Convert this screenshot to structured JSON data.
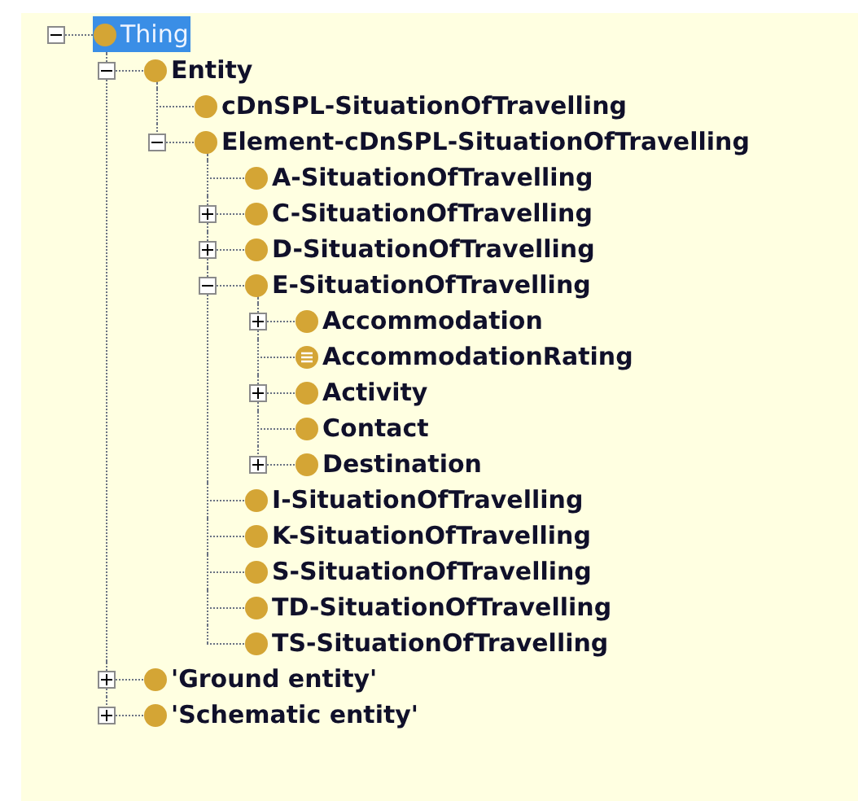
{
  "tree": {
    "items": [
      {
        "label": "Thing",
        "kind": "class",
        "selected": true,
        "expanded": true,
        "children": [
          {
            "label": "Entity",
            "kind": "class",
            "selected": false,
            "expanded": true,
            "children": [
              {
                "label": "cDnSPL-SituationOfTravelling",
                "kind": "class",
                "selected": false
              },
              {
                "label": "Element-cDnSPL-SituationOfTravelling",
                "kind": "class",
                "selected": false,
                "expanded": true,
                "children": [
                  {
                    "label": "A-SituationOfTravelling",
                    "kind": "class",
                    "selected": false
                  },
                  {
                    "label": "C-SituationOfTravelling",
                    "kind": "class",
                    "selected": false,
                    "expanded": false
                  },
                  {
                    "label": "D-SituationOfTravelling",
                    "kind": "class",
                    "selected": false,
                    "expanded": false
                  },
                  {
                    "label": "E-SituationOfTravelling",
                    "kind": "class",
                    "selected": false,
                    "expanded": true,
                    "children": [
                      {
                        "label": "Accommodation",
                        "kind": "class",
                        "selected": false,
                        "expanded": false
                      },
                      {
                        "label": "AccommodationRating",
                        "kind": "enumerated",
                        "selected": false
                      },
                      {
                        "label": "Activity",
                        "kind": "class",
                        "selected": false,
                        "expanded": false
                      },
                      {
                        "label": "Contact",
                        "kind": "class",
                        "selected": false
                      },
                      {
                        "label": "Destination",
                        "kind": "class",
                        "selected": false,
                        "expanded": false
                      }
                    ]
                  },
                  {
                    "label": "I-SituationOfTravelling",
                    "kind": "class",
                    "selected": false
                  },
                  {
                    "label": "K-SituationOfTravelling",
                    "kind": "class",
                    "selected": false
                  },
                  {
                    "label": "S-SituationOfTravelling",
                    "kind": "class",
                    "selected": false
                  },
                  {
                    "label": "TD-SituationOfTravelling",
                    "kind": "class",
                    "selected": false
                  },
                  {
                    "label": "TS-SituationOfTravelling",
                    "kind": "class",
                    "selected": false
                  }
                ]
              }
            ]
          },
          {
            "label": "'Ground entity'",
            "kind": "class",
            "selected": false,
            "expanded": false
          },
          {
            "label": "'Schematic entity'",
            "kind": "class",
            "selected": false,
            "expanded": false
          }
        ]
      }
    ]
  }
}
